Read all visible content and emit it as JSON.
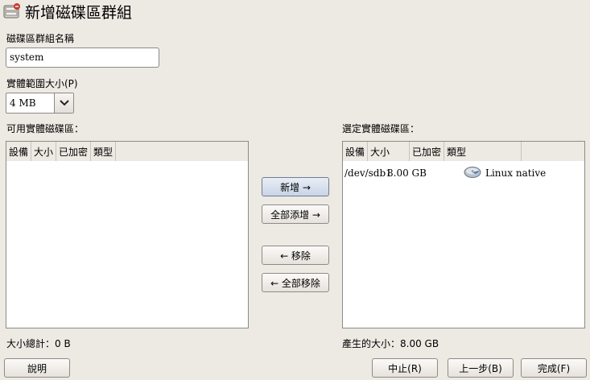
{
  "window": {
    "title": "新增磁碟區群組"
  },
  "form": {
    "name_label": "磁碟區群組名稱",
    "name_value": "system",
    "extent_label": "實體範圍大小(P)",
    "extent_value": "4 MB"
  },
  "available": {
    "label": "可用實體磁碟區：",
    "columns": [
      "設備",
      "大小",
      "已加密",
      "類型"
    ],
    "rows": [],
    "total_label": "大小總計：0 B"
  },
  "selected": {
    "label": "選定實體磁碟區：",
    "columns": [
      "設備",
      "大小",
      "已加密",
      "類型"
    ],
    "rows": [
      {
        "device": "/dev/sdb1",
        "size": "8.00 GB",
        "encrypted": "",
        "type_icon": "disk-icon",
        "type": "Linux native"
      }
    ],
    "result_label": "產生的大小：8.00 GB"
  },
  "transfer": {
    "add": "新增 →",
    "add_all": "全部添增 →",
    "remove": "← 移除",
    "remove_all": "← 全部移除"
  },
  "footer": {
    "help": "說明",
    "abort": "中止(R)",
    "back": "上一步(B)",
    "finish": "完成(F)"
  }
}
